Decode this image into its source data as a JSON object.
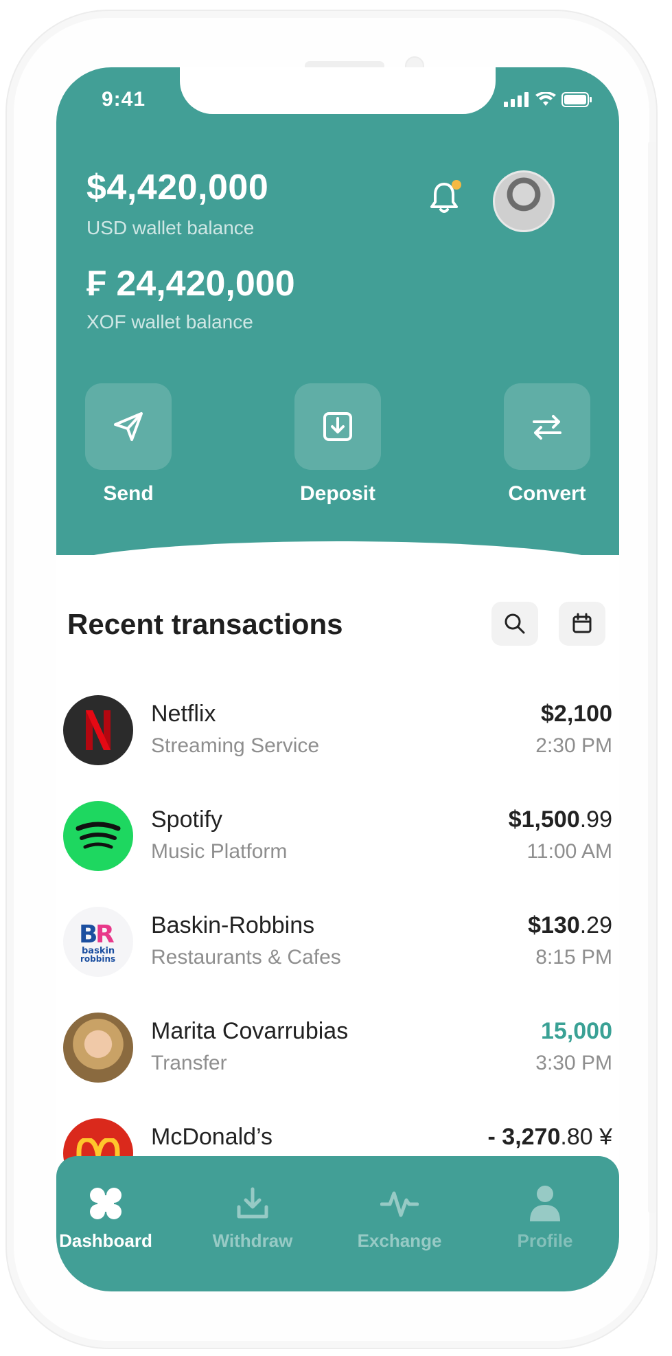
{
  "status_bar": {
    "time": "9:41"
  },
  "wallet": {
    "usd_balance": "$4,420,000",
    "usd_label": "USD wallet balance",
    "xof_balance": "₣ 24,420,000",
    "xof_label": "XOF wallet balance"
  },
  "actions": [
    {
      "label": "Send",
      "icon": "send-icon"
    },
    {
      "label": "Deposit",
      "icon": "deposit-icon"
    },
    {
      "label": "Convert",
      "icon": "convert-icon"
    }
  ],
  "recent": {
    "title": "Recent transactions"
  },
  "transactions": [
    {
      "name": "Netflix",
      "category": "Streaming Service",
      "amount_main": "$2,100",
      "amount_dec": "",
      "time": "2:30 PM",
      "logo": "netflix-logo"
    },
    {
      "name": "Spotify",
      "category": "Music Platform",
      "amount_main": "$1,500",
      "amount_dec": ".99",
      "time": "11:00 AM",
      "logo": "spotify-logo"
    },
    {
      "name": "Baskin-Robbins",
      "category": "Restaurants & Cafes",
      "amount_main": "$130",
      "amount_dec": ".29",
      "time": "8:15 PM",
      "logo": "baskin-robbins-logo"
    },
    {
      "name": "Marita Covarrubias",
      "category": "Transfer",
      "amount_main": "15,000",
      "amount_dec": "",
      "time": "3:30 PM",
      "logo": "person-avatar"
    },
    {
      "name": "McDonald’s",
      "category": "",
      "amount_main": "- 3,270",
      "amount_dec": ".80 ¥",
      "time": "",
      "logo": "mcdonalds-logo"
    }
  ],
  "nav": [
    {
      "label": "Dashboard",
      "icon": "dashboard-icon",
      "active": true
    },
    {
      "label": "Withdraw",
      "icon": "withdraw-icon",
      "active": false
    },
    {
      "label": "Exchange",
      "icon": "exchange-icon",
      "active": false
    },
    {
      "label": "Profile",
      "icon": "profile-icon",
      "active": false
    }
  ],
  "colors": {
    "primary": "#429f96",
    "positive": "#3aa195",
    "notification_dot": "#f5b942"
  }
}
